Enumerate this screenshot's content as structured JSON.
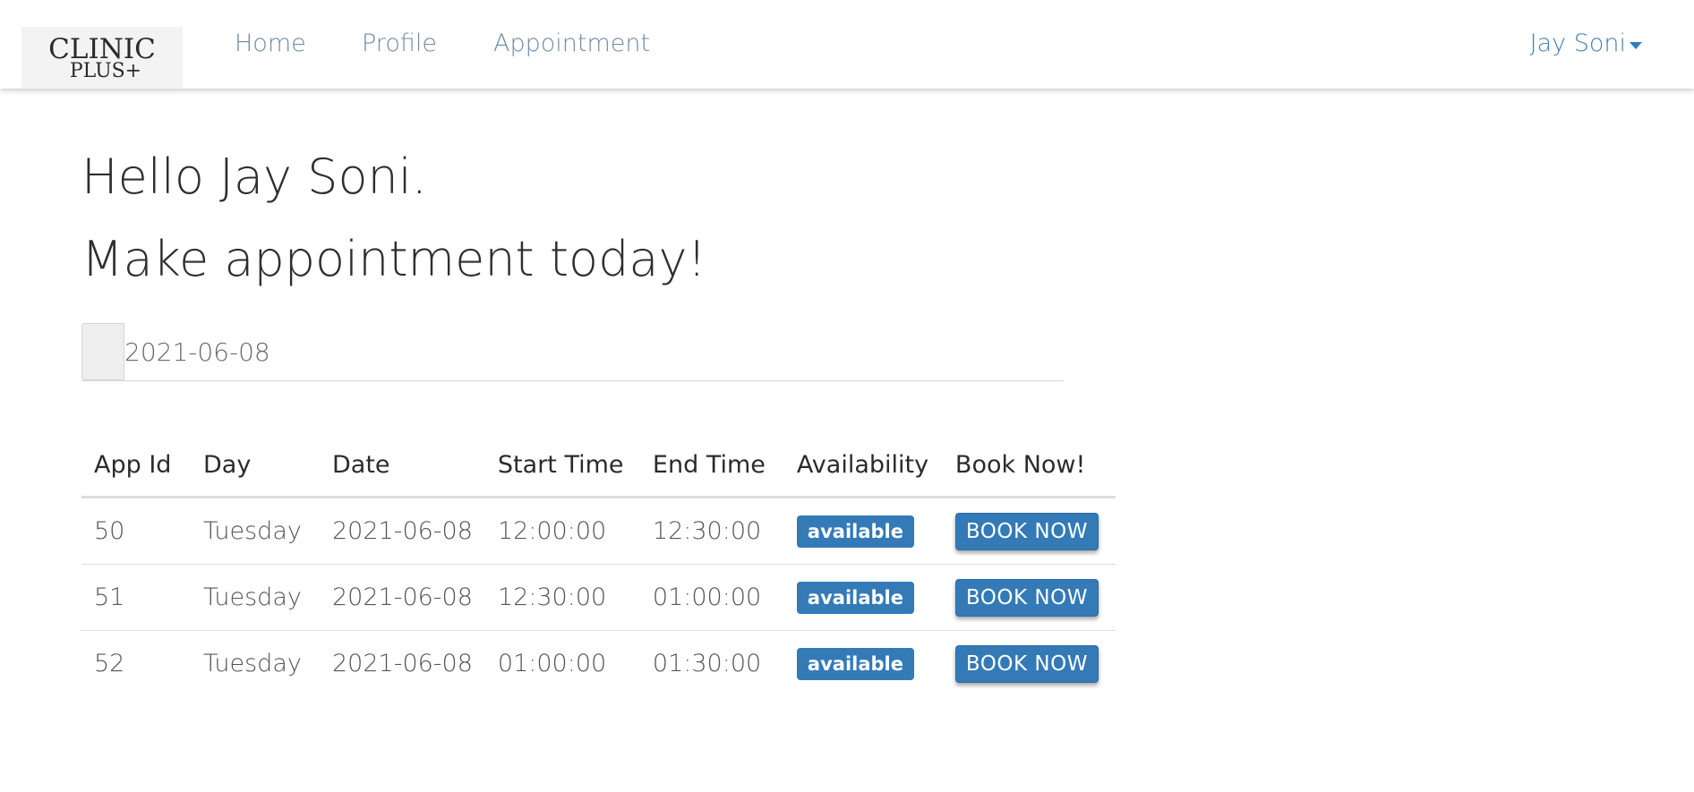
{
  "navbar": {
    "logo_main": "CLINIC",
    "logo_sub": "PLUS+",
    "links": [
      "Home",
      "Profile",
      "Appointment"
    ],
    "user_name": "Jay Soni"
  },
  "main": {
    "greeting": "Hello Jay Soni.",
    "subheading": "Make appointment today!",
    "date_value": "2021-06-08"
  },
  "table": {
    "headers": [
      "App Id",
      "Day",
      "Date",
      "Start Time",
      "End Time",
      "Availability",
      "Book Now!"
    ],
    "rows": [
      {
        "app_id": "50",
        "day": "Tuesday",
        "date": "2021-06-08",
        "start": "12:00:00",
        "end": "12:30:00",
        "availability": "available",
        "action": "BOOK NOW"
      },
      {
        "app_id": "51",
        "day": "Tuesday",
        "date": "2021-06-08",
        "start": "12:30:00",
        "end": "01:00:00",
        "availability": "available",
        "action": "BOOK NOW"
      },
      {
        "app_id": "52",
        "day": "Tuesday",
        "date": "2021-06-08",
        "start": "01:00:00",
        "end": "01:30:00",
        "availability": "available",
        "action": "BOOK NOW"
      }
    ]
  },
  "colors": {
    "accent": "#337ab7",
    "nav_link": "#6f8ba3",
    "text": "#2b2b2b"
  }
}
